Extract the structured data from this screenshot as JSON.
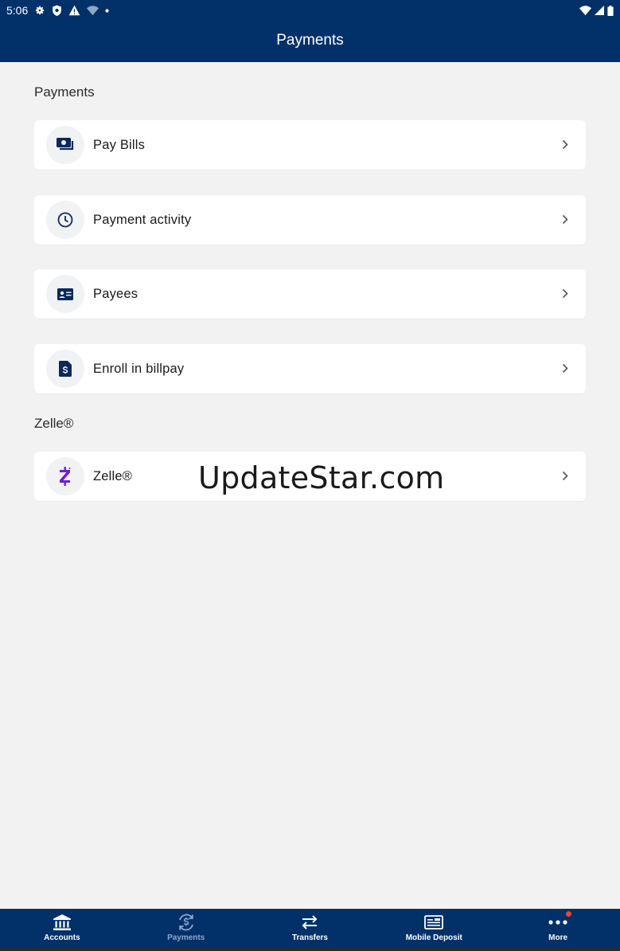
{
  "status_bar": {
    "time": "5:06"
  },
  "header": {
    "title": "Payments"
  },
  "sections": [
    {
      "title": "Payments",
      "items": [
        {
          "label": "Pay Bills",
          "icon": "bill-icon"
        },
        {
          "label": "Payment activity",
          "icon": "clock-icon"
        },
        {
          "label": "Payees",
          "icon": "contact-card-icon"
        },
        {
          "label": "Enroll in billpay",
          "icon": "document-dollar-icon"
        }
      ]
    },
    {
      "title": "Zelle®",
      "items": [
        {
          "label": "Zelle®",
          "icon": "zelle-logo-icon"
        }
      ]
    }
  ],
  "watermark": "UpdateStar.com",
  "bottom_nav": [
    {
      "label": "Accounts",
      "icon": "bank-icon",
      "active": false
    },
    {
      "label": "Payments",
      "icon": "dollar-cycle-icon",
      "active": true
    },
    {
      "label": "Transfers",
      "icon": "transfer-arrows-icon",
      "active": false
    },
    {
      "label": "Mobile Deposit",
      "icon": "check-deposit-icon",
      "active": false
    },
    {
      "label": "More",
      "icon": "more-dots-icon",
      "active": false,
      "badge": true
    }
  ],
  "colors": {
    "header_bg": "#02316a",
    "icon_primary": "#0b2a5b",
    "zelle_purple": "#6d1ed4",
    "active_nav": "#8ea8cc",
    "badge": "#e8453c"
  }
}
